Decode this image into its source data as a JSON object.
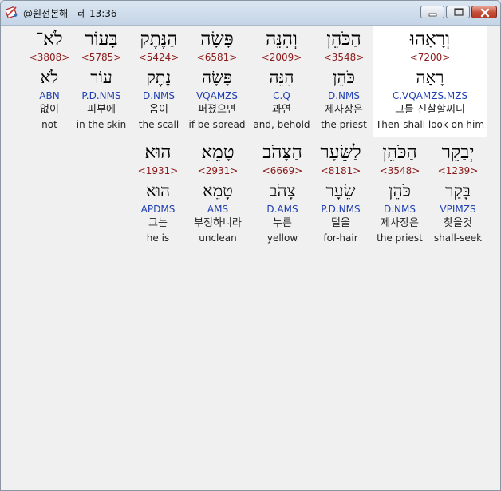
{
  "window": {
    "title": "@원전본해 - 레 13:36",
    "min_label": "minimize",
    "max_label": "maximize",
    "close_label": "close"
  },
  "rows": [
    {
      "words": [
        {
          "hebrew": "וְרָאָהוּ",
          "strong": "<7200>",
          "lemma": "רָאָה",
          "parse": "C.VQAMZS.MZS",
          "korean": "그를 진찰할찌니",
          "english": "Then-shall look on him",
          "highlight": true
        },
        {
          "hebrew": "הַכֹּהֵן",
          "strong": "<3548>",
          "lemma": "כֹּהֵן",
          "parse": "D.NMS",
          "korean": "제사장은",
          "english": "the priest"
        },
        {
          "hebrew": "וְהִנֵּה",
          "strong": "<2009>",
          "lemma": "הִנֵּה",
          "parse": "C.Q",
          "korean": "과연",
          "english": "and, behold"
        },
        {
          "hebrew": "פָּשָׂה",
          "strong": "<6581>",
          "lemma": "פָּשָׂה",
          "parse": "VQAMZS",
          "korean": "퍼졌으면",
          "english": "if-be spread"
        },
        {
          "hebrew": "הַנֶּתֶק",
          "strong": "<5424>",
          "lemma": "נֶתֶק",
          "parse": "D.NMS",
          "korean": "옴이",
          "english": "the scall"
        },
        {
          "hebrew": "בָּעוֹר",
          "strong": "<5785>",
          "lemma": "עוֹר",
          "parse": "P.D.NMS",
          "korean": "피부에",
          "english": "in the skin"
        },
        {
          "hebrew": "לֹא־",
          "strong": "<3808>",
          "lemma": "לֹא",
          "parse": "ABN",
          "korean": "없이",
          "english": "not"
        }
      ]
    },
    {
      "words": [
        {
          "hebrew": "יְבַקֵּר",
          "strong": "<1239>",
          "lemma": "בָּקַר",
          "parse": "VPIMZS",
          "korean": "찾을것",
          "english": "shall-seek"
        },
        {
          "hebrew": "הַכֹּהֵן",
          "strong": "<3548>",
          "lemma": "כֹּהֵן",
          "parse": "D.NMS",
          "korean": "제사장은",
          "english": "the priest"
        },
        {
          "hebrew": "לַשֵּׂעָר",
          "strong": "<8181>",
          "lemma": "שֵׂעָר",
          "parse": "P.D.NMS",
          "korean": "털을",
          "english": "for-hair"
        },
        {
          "hebrew": "הַצָּהֹב",
          "strong": "<6669>",
          "lemma": "צָהֹב",
          "parse": "D.AMS",
          "korean": "누른",
          "english": "yellow"
        },
        {
          "hebrew": "טָמֵא",
          "strong": "<2931>",
          "lemma": "טָמֵא",
          "parse": "AMS",
          "korean": "부정하니라",
          "english": "unclean"
        },
        {
          "hebrew": "הוּא׃",
          "strong": "<1931>",
          "lemma": "הוּא",
          "parse": "APDMS",
          "korean": "그는",
          "english": "he is"
        }
      ]
    }
  ]
}
